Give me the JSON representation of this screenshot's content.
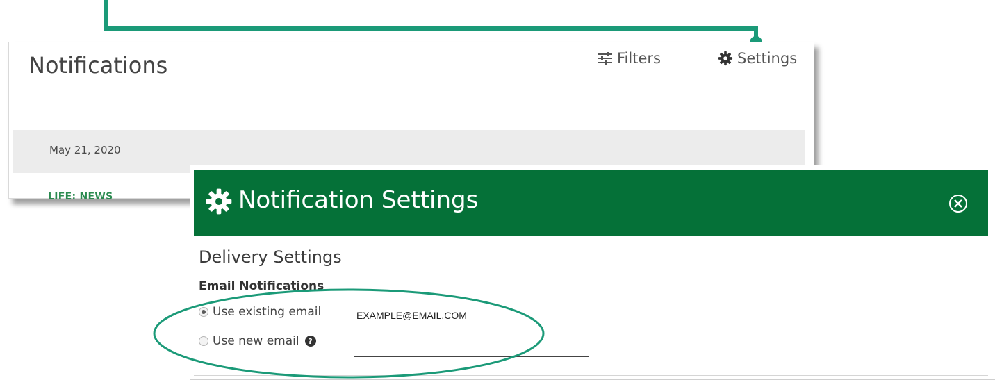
{
  "notifications_page": {
    "title": "Notifications",
    "filters_label": "Filters",
    "settings_label": "Settings",
    "date": "May 21, 2020",
    "category": "LIFE: NEWS"
  },
  "modal": {
    "title": "Notification Settings",
    "section_title": "Delivery Settings",
    "email_section_title": "Email Notifications",
    "options": [
      {
        "label": "Use existing email",
        "selected": true,
        "value": "EXAMPLE@EMAIL.COM"
      },
      {
        "label": "Use new email",
        "selected": false,
        "value": ""
      }
    ],
    "help_glyph": "?"
  },
  "colors": {
    "header_green": "#057138",
    "callout_teal": "#1b9a78",
    "category_green": "#2a8a4f"
  },
  "icons": {
    "filters": "sliders-icon",
    "settings": "gear-icon",
    "close": "close-circle-icon",
    "help": "question-circle-icon"
  }
}
